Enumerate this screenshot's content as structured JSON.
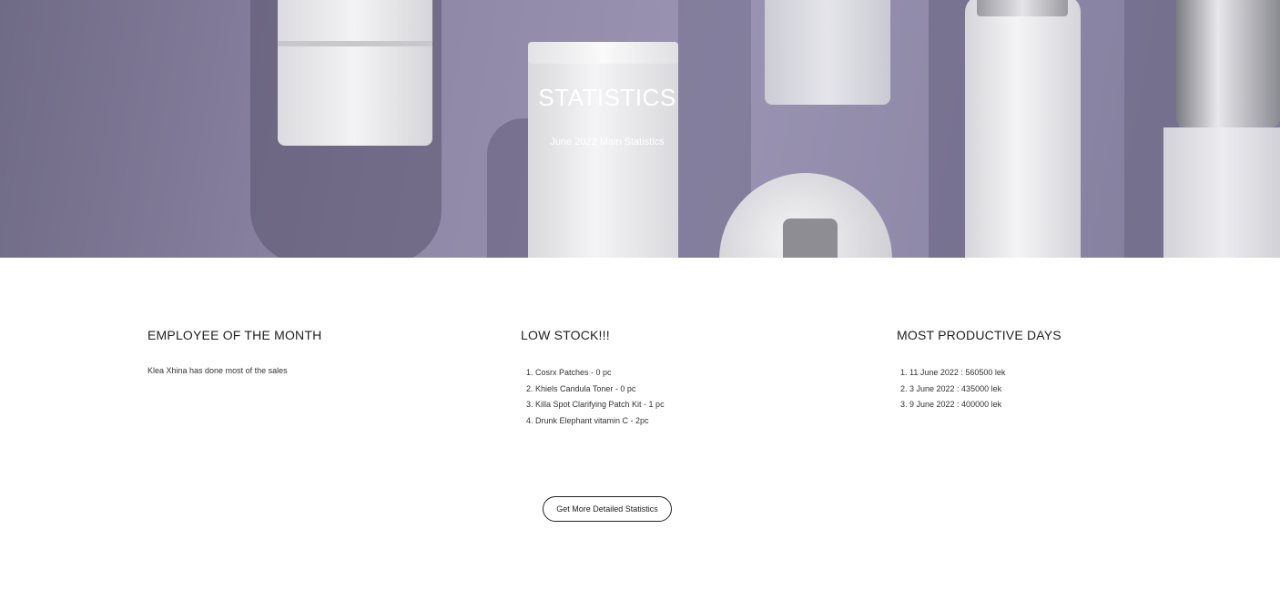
{
  "hero": {
    "title": "STATISTICS",
    "subtitle": "June 2022 Main Statistics"
  },
  "employee": {
    "heading": "EMPLOYEE OF THE MONTH",
    "text": "Klea Xhina has done most of the sales"
  },
  "low_stock": {
    "heading": "LOW STOCK!!!",
    "items": [
      "1. Cosrx Patches - 0 pc",
      "2. Khiels Candula Toner - 0 pc",
      "3. Killa Spot Clarifying Patch Kit - 1 pc",
      "4. Drunk Elephant vitamin C - 2pc"
    ]
  },
  "productive_days": {
    "heading": "MOST PRODUCTIVE DAYS",
    "items": [
      "1. 11 June 2022 : 560500 lek",
      "2. 3 June 2022 : 435000 lek",
      "3. 9 June 2022 : 400000 lek"
    ]
  },
  "cta": {
    "label": "Get More Detailed Statistics"
  }
}
